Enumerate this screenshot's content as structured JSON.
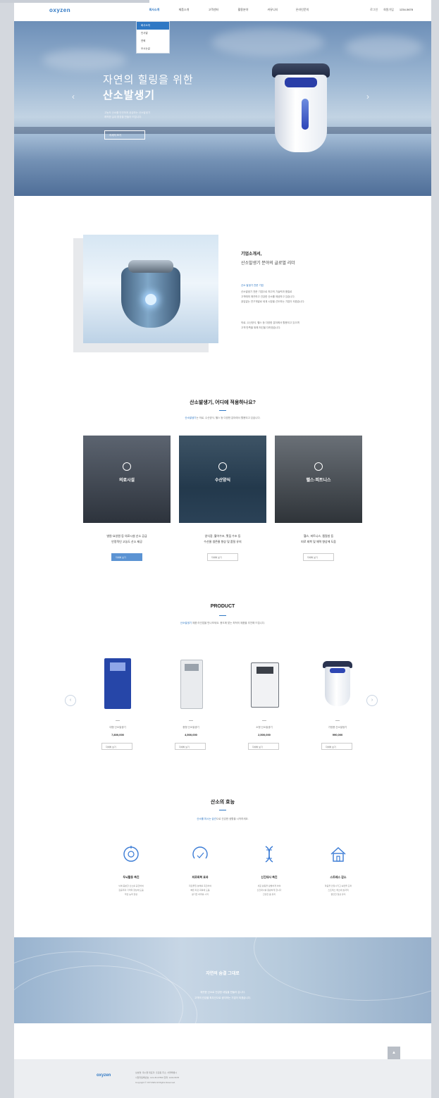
{
  "header": {
    "logo": "oxyzen",
    "nav": [
      "회사소개",
      "제품소개",
      "고객센터",
      "활용분야",
      "커뮤니티",
      "온라인문의"
    ],
    "active_nav": 0,
    "util": [
      "로그인",
      "회원가입"
    ],
    "phone": "1234-5678",
    "dropdown": [
      "회사소개",
      "인사말",
      "연혁",
      "오시는길"
    ]
  },
  "hero": {
    "title1": "자연의 힐링을 위한",
    "title2": "산소발생기",
    "desc1": "고농도 산소를 안전하게 공급하는 산소발생기",
    "desc2": "쾌적한 실내 환경을 만들어 드립니다.",
    "button": "자세히 보기",
    "prev_icon": "‹",
    "next_icon": "›"
  },
  "intro": {
    "title1": "기업소개서,",
    "title2": "산소발생기 분야의 글로벌 리더",
    "highlight": "산소 발생기 전문 기업",
    "paras": [
      "산소발생기 전문 기업으로 최고의 기술력과 품질로",
      "고객에게 깨끗하고 건강한 산소를 제공하고 있습니다.",
      "끊임없는 연구개발로 세계 시장을 선도하는 기업이 되겠습니다.",
      "",
      "의료, 수산양식, 헬스 등 다양한 분야에서 활용되고 있으며",
      "고객 만족을 위해 최선을 다하겠습니다."
    ]
  },
  "usage": {
    "title": "산소발생기, 어디에 적용하나요?",
    "sub_hl": "산소발생기",
    "sub": "는 의료, 수산양식, 헬스 등 다양한 분야에서 활용되고 있습니다.",
    "cards": [
      {
        "label": "의료시설",
        "t1": "병원·요양원 등 의료시설 산소 공급",
        "t2": "안정적인 고농도 산소 제공",
        "btn": "자세히 보기"
      },
      {
        "label": "수산양식",
        "t1": "양식장, 활어수조, 횟집 수조 등",
        "t2": "수산물 생존율 향상 및 품질 유지",
        "btn": "자세히 보기"
      },
      {
        "label": "헬스·피트니스",
        "t1": "헬스, 피트니스, 찜질방 등",
        "t2": "피로 회복 및 체력 향상에 도움",
        "btn": "자세히 보기"
      }
    ]
  },
  "product": {
    "title": "PRODUCT",
    "sub_hl": "산소발생기",
    "sub": " 제품 라인업을 만나보세요. 용도에 맞는 최적의 제품을 추천해 드립니다.",
    "items": [
      {
        "name": "대형 산소발생기",
        "price": "7,800,000",
        "btn": "자세히 보기",
        "color": "#2646a8"
      },
      {
        "name": "중형 산소발생기",
        "price": "4,500,000",
        "btn": "자세히 보기",
        "color": "#e9ebee"
      },
      {
        "name": "소형 산소발생기",
        "price": "2,500,000",
        "btn": "자세히 보기",
        "color": "#f1f2f4"
      },
      {
        "name": "가정용 산소발생기",
        "price": "990,000",
        "btn": "자세히 보기",
        "color": "#ffffff"
      }
    ]
  },
  "effect": {
    "title": "산소의 효능",
    "sub_hl": "산소를 마시는 습관",
    "sub": "으로 건강한 생활을 시작하세요.",
    "items": [
      {
        "title": "두뇌활동 촉진",
        "d1": "뇌에 충분한 산소를 공급하여",
        "d2": "집중력과 기억력 향상에 도움",
        "d3": "학습 능력 향상"
      },
      {
        "title": "피로회복 효과",
        "d1": "피로물질 분해를 촉진하여",
        "d2": "빠른 피로 회복에 도움",
        "d3": "활기찬 하루를 시작"
      },
      {
        "title": "신진대사 촉진",
        "d1": "세포 활동을 활발하게 하여",
        "d2": "신진대사를 원활하게 합니다",
        "d3": "건강한 몸 유지"
      },
      {
        "title": "스트레스 감소",
        "d1": "마음을 안정시키고 숙면을 도와",
        "d2": "스트레스 해소에 효과적",
        "d3": "편안한 일상 유지"
      }
    ]
  },
  "banner": {
    "title": "자연의 숨결 그대로",
    "sub1": "깨끗한 산소로 건강한 내일을 만들어 갑니다.",
    "sub2": "고객의 건강을 최우선으로 생각하는 기업이 되겠습니다."
  },
  "footer": {
    "logo": "oxyzen",
    "line1": "상호명: 옥시젠  대표자: 홍길동  주소: 서울특별시",
    "line2": "사업자등록번호: 123-45-67890  전화: 1234-5678",
    "line3": "Copyright © OXYZEN All Rights Reserved.",
    "top_btn": "▲"
  }
}
